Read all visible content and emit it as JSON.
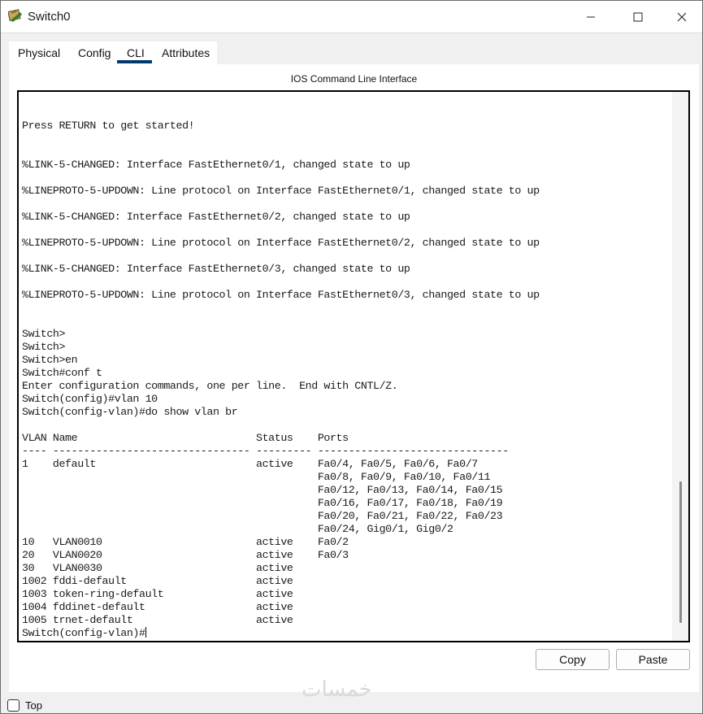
{
  "window": {
    "title": "Switch0",
    "icon": "switch-device-icon",
    "controls": [
      "minimize-icon",
      "maximize-icon",
      "close-icon"
    ]
  },
  "tabs": [
    {
      "label": "Physical",
      "active": false
    },
    {
      "label": "Config",
      "active": false
    },
    {
      "label": "CLI",
      "active": true
    },
    {
      "label": "Attributes",
      "active": false
    }
  ],
  "cli": {
    "panel_title": "IOS Command Line Interface",
    "lines": [
      "",
      "",
      "Press RETURN to get started!",
      "",
      "",
      "%LINK-5-CHANGED: Interface FastEthernet0/1, changed state to up",
      "",
      "%LINEPROTO-5-UPDOWN: Line protocol on Interface FastEthernet0/1, changed state to up",
      "",
      "%LINK-5-CHANGED: Interface FastEthernet0/2, changed state to up",
      "",
      "%LINEPROTO-5-UPDOWN: Line protocol on Interface FastEthernet0/2, changed state to up",
      "",
      "%LINK-5-CHANGED: Interface FastEthernet0/3, changed state to up",
      "",
      "%LINEPROTO-5-UPDOWN: Line protocol on Interface FastEthernet0/3, changed state to up",
      "",
      "",
      "Switch>",
      "Switch>",
      "Switch>en",
      "Switch#conf t",
      "Enter configuration commands, one per line.  End with CNTL/Z.",
      "Switch(config)#vlan 10",
      "Switch(config-vlan)#do show vlan br",
      "",
      "VLAN Name                             Status    Ports",
      "---- -------------------------------- --------- -------------------------------",
      "1    default                          active    Fa0/4, Fa0/5, Fa0/6, Fa0/7",
      "                                                Fa0/8, Fa0/9, Fa0/10, Fa0/11",
      "                                                Fa0/12, Fa0/13, Fa0/14, Fa0/15",
      "                                                Fa0/16, Fa0/17, Fa0/18, Fa0/19",
      "                                                Fa0/20, Fa0/21, Fa0/22, Fa0/23",
      "                                                Fa0/24, Gig0/1, Gig0/2",
      "10   VLAN0010                         active    Fa0/2",
      "20   VLAN0020                         active    Fa0/3",
      "30   VLAN0030                         active    ",
      "1002 fddi-default                     active    ",
      "1003 token-ring-default               active    ",
      "1004 fddinet-default                  active    ",
      "1005 trnet-default                    active    "
    ],
    "prompt": "Switch(config-vlan)#"
  },
  "buttons": {
    "copy": "Copy",
    "paste": "Paste"
  },
  "footer": {
    "top_checkbox_label": "Top",
    "top_checked": false
  },
  "watermark": "خمسات"
}
